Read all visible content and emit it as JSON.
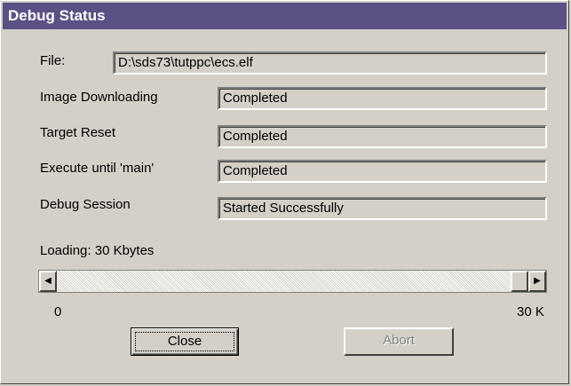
{
  "window": {
    "title": "Debug Status"
  },
  "file": {
    "label": "File:",
    "value": "D:\\sds73\\tutppc\\ecs.elf"
  },
  "status_rows": [
    {
      "label": "Image Downloading",
      "value": "Completed"
    },
    {
      "label": "Target Reset",
      "value": "Completed"
    },
    {
      "label": "Execute until 'main'",
      "value": "Completed"
    },
    {
      "label": "Debug Session",
      "value": "Started Successfully"
    }
  ],
  "loading": {
    "label": "Loading:  30 Kbytes",
    "min_label": "0",
    "max_label": "30 K",
    "progress_fraction": 1.0
  },
  "buttons": {
    "close": "Close",
    "abort": "Abort"
  },
  "icons": {
    "scroll_left": "arrow-left-icon",
    "scroll_right": "arrow-right-icon"
  },
  "colors": {
    "titlebar": "#5b5184",
    "face": "#d4d0c8"
  }
}
